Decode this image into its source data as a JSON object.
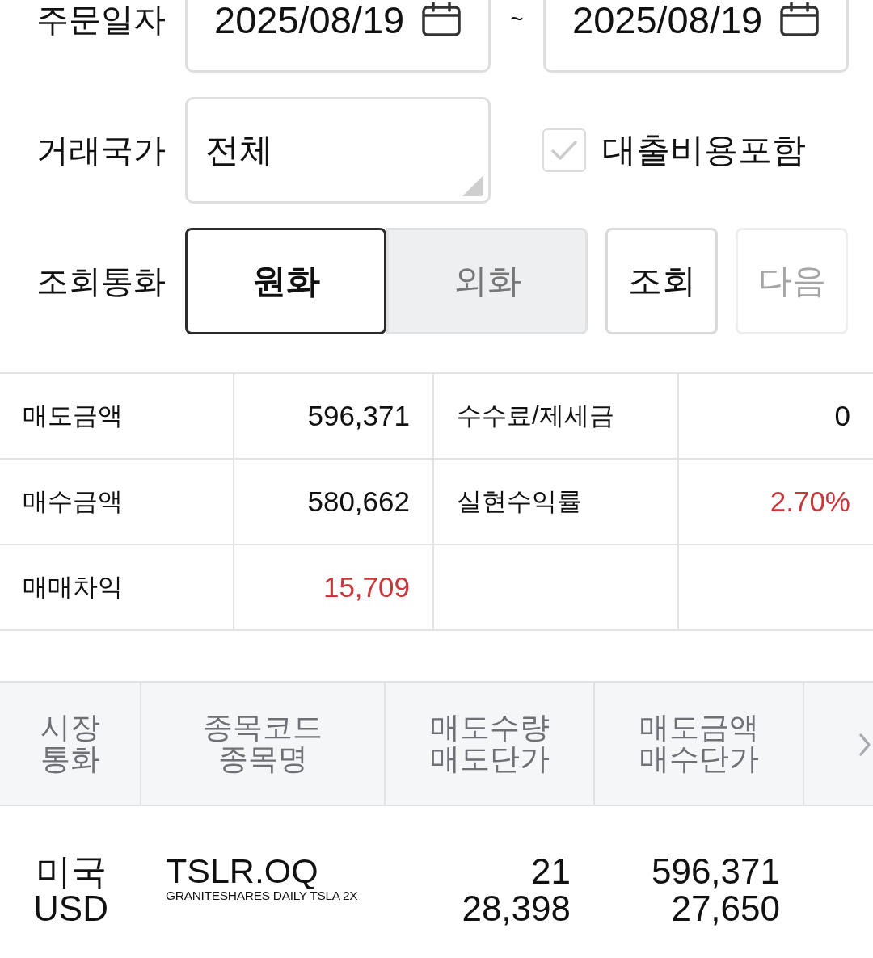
{
  "filters": {
    "order_date": {
      "label": "주문일자",
      "from": "2025/08/19",
      "separator": "~",
      "to": "2025/08/19"
    },
    "country": {
      "label": "거래국가",
      "value": "전체"
    },
    "loan_cost": {
      "label": "대출비용포함",
      "checked": false
    },
    "currency": {
      "label": "조회통화",
      "options": [
        {
          "label": "원화",
          "selected": true
        },
        {
          "label": "외화",
          "selected": false
        }
      ]
    },
    "buttons": [
      {
        "label": "조회",
        "disabled": false
      },
      {
        "label": "다음",
        "disabled": true
      }
    ]
  },
  "summary": {
    "rows": [
      [
        {
          "label": "매도금액",
          "value": "596,371",
          "color": "#111111"
        },
        {
          "label": "수수료/제세금",
          "value": "0",
          "color": "#111111"
        }
      ],
      [
        {
          "label": "매수금액",
          "value": "580,662",
          "color": "#111111"
        },
        {
          "label": "실현수익률",
          "value": "2.70%",
          "color": "#c8373a"
        }
      ],
      [
        {
          "label": "매매차익",
          "value": "15,709",
          "color": "#c8373a"
        }
      ]
    ]
  },
  "trades": {
    "columns": [
      {
        "lines": [
          "시장",
          "통화"
        ]
      },
      {
        "lines": [
          "종목코드",
          "종목명"
        ]
      },
      {
        "lines": [
          "매도수량",
          "매도단가"
        ]
      },
      {
        "lines": [
          "매도금액",
          "매수단가"
        ]
      }
    ],
    "rows": [
      {
        "market": "미국",
        "currency": "USD",
        "code": "TSLR.OQ",
        "name": "GRANITESHARES DAILY TSLA 2X",
        "sell_quantity": "21",
        "sell_price": "28,398",
        "sell_amount": "596,371",
        "buy_price": "27,650"
      }
    ]
  }
}
